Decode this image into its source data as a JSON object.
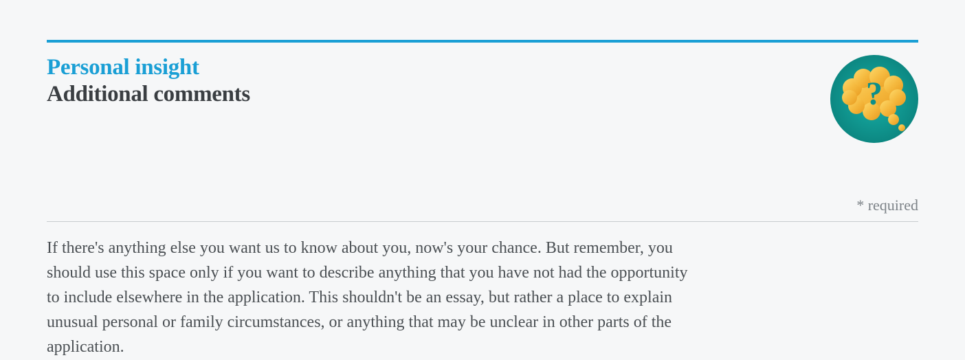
{
  "header": {
    "eyebrow": "Personal insight",
    "title": "Additional comments"
  },
  "required_note": "* required",
  "body": "If there's anything else you want us to know about you, now's your chance. But remember, you should use this space only if you want to describe anything that you have not had the opportunity to include elsewhere in the application. This shouldn't be an essay, but rather a place to explain unusual personal or family circumstances, or anything that may be unclear in other parts of the application.",
  "icon": {
    "name": "question-bubble-icon",
    "background_color": "#0c8f8a",
    "bubble_color": "#f5b93e",
    "question_color": "#0c8f8a"
  }
}
